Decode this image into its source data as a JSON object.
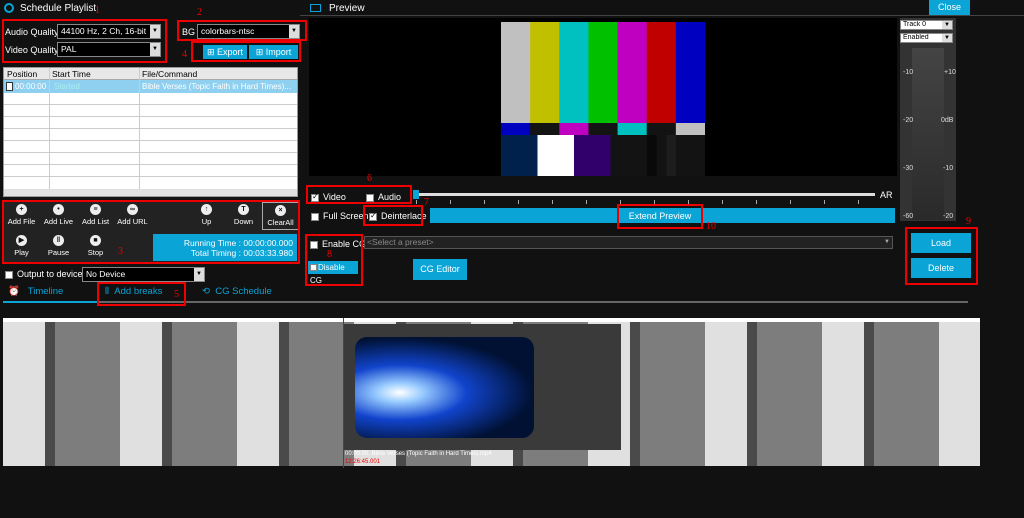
{
  "left_panel": {
    "title": "Schedule Playlist",
    "audio_quality_label": "Audio Quality",
    "audio_quality_value": "44100 Hz, 2 Ch, 16-bit",
    "video_quality_label": "Video Quality",
    "video_quality_value": "PAL",
    "bg_label": "BG",
    "bg_value": "colorbars-ntsc",
    "export_label": "Export",
    "import_label": "Import",
    "table": {
      "headers": [
        "Position",
        "Start Time",
        "File/Command"
      ],
      "rows": [
        {
          "position": "00:00:00",
          "start": "Started",
          "file": "Bible Verses (Topic Faith in Hard Times)..."
        }
      ]
    },
    "toolbar": [
      {
        "label": "Add File",
        "icon": "add-file-icon",
        "glyph": "+"
      },
      {
        "label": "Add Live",
        "icon": "live-icon",
        "glyph": "•"
      },
      {
        "label": "Add List",
        "icon": "list-icon",
        "glyph": "≡"
      },
      {
        "label": "Add URL",
        "icon": "url-icon",
        "glyph": "∞"
      },
      {
        "label": "",
        "icon": "blank-icon",
        "glyph": ""
      },
      {
        "label": "Up",
        "icon": "up-icon",
        "glyph": "↑"
      },
      {
        "label": "Down",
        "icon": "down-icon",
        "glyph": "T"
      },
      {
        "label": "ClearAll",
        "icon": "clear-icon",
        "glyph": "×"
      }
    ],
    "play_label": "Play",
    "pause_label": "Pause",
    "stop_label": "Stop",
    "running_time": "Running Time : 00:00:00.000",
    "total_timing": "Total Timing : 00:03:33.980",
    "output_label": "Output to device",
    "device_value": "No Device"
  },
  "tabs": {
    "timeline": "Timeline",
    "add_breaks": "Add breaks",
    "cg_schedule": "CG Schedule"
  },
  "preview": {
    "title": "Preview",
    "close_label": "Close",
    "video_label": "Video",
    "audio_label": "Audio",
    "ar_label": "AR",
    "full_screen_label": "Full Screen",
    "deinterlace_label": "Deinterlace",
    "extend_preview_label": "Extend Preview",
    "enable_cg_label": "Enable CG",
    "disable_cg_label": "Disable CG",
    "preset_placeholder": "<Select a preset>",
    "cg_editor_label": "CG Editor",
    "load_label": "Load",
    "delete_label": "Delete"
  },
  "audio_meter": {
    "track_value": "Track 0",
    "enabled_value": "Enabled",
    "left_scale": [
      "-10",
      "-20",
      "-30",
      "-60"
    ],
    "right_scale": [
      "+10",
      "0dB",
      "-10",
      "-20"
    ]
  },
  "colorbars": {
    "top": [
      "#c0c0c0",
      "#c0c000",
      "#00c0c0",
      "#00c000",
      "#c000c0",
      "#c00000",
      "#0000c0"
    ],
    "mid": [
      "#0000c0",
      "#131313",
      "#c000c0",
      "#131313",
      "#00c0c0",
      "#131313",
      "#c0c0c0"
    ]
  },
  "timeline": {
    "clip_label": "00:00:00, Bible Verses (Topic Faith in Hard Times).mp4",
    "clip_time": "12:26:45.001"
  },
  "annotations": [
    "1",
    "2",
    "3",
    "4",
    "5",
    "6",
    "7",
    "8",
    "9",
    "10"
  ],
  "colors": {
    "accent": "#0aa4d6",
    "annotation": "#e00000",
    "selected_row": "#8fd0f0"
  }
}
